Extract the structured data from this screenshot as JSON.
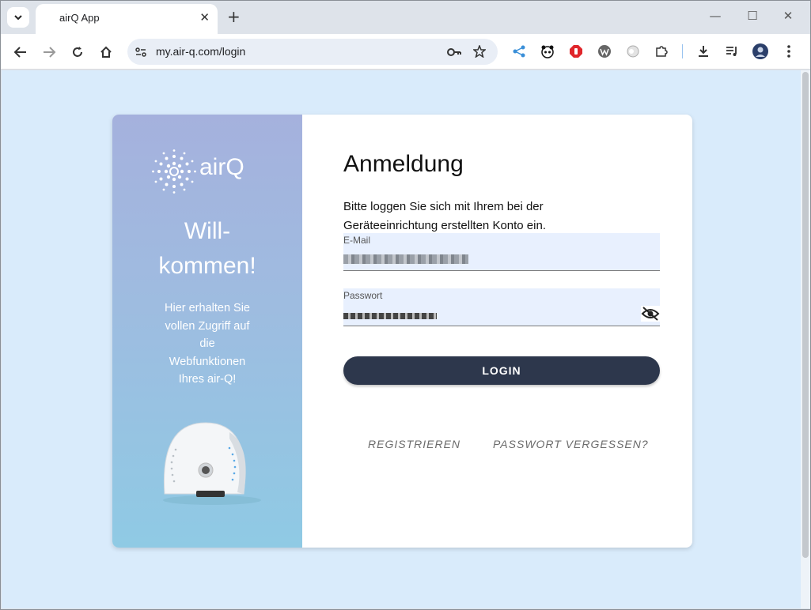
{
  "browser": {
    "tab_title": "airQ App",
    "url": "my.air-q.com/login"
  },
  "brand": {
    "logo_text": "airQ"
  },
  "left": {
    "welcome_line1": "Will-",
    "welcome_line2": "kommen!",
    "text_lines": [
      "Hier erhalten Sie",
      "vollen Zugriff auf",
      "die",
      "Webfunktionen",
      "Ihres air-Q!"
    ]
  },
  "form": {
    "heading": "Anmeldung",
    "instruction_line1": "Bitte loggen Sie sich mit Ihrem bei der",
    "instruction_line2": "Geräteeinrichtung erstellten Konto ein.",
    "email_label": "E-Mail",
    "password_label": "Passwort",
    "login_label": "LOGIN",
    "register_label": "REGISTRIEREN",
    "forgot_label": "PASSWORT VERGESSEN?"
  },
  "colors": {
    "page_bg": "#d9ebfb",
    "button_bg": "#2d374c",
    "field_bg": "#e8f0fe"
  }
}
